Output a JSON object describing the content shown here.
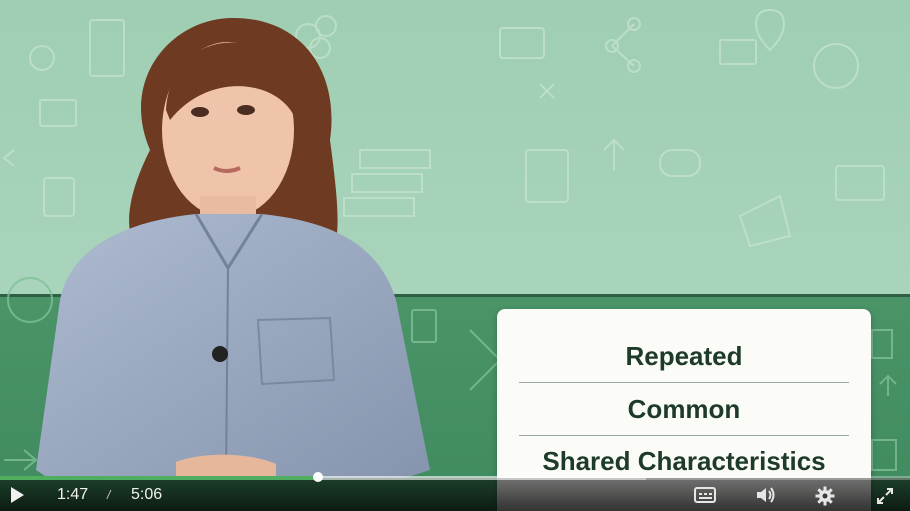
{
  "card": {
    "items": [
      "Repeated",
      "Common",
      "Shared Characteristics"
    ]
  },
  "player": {
    "current_time": "1:47",
    "separator": "/",
    "duration": "5:06",
    "progress": 0.349,
    "buffered": 0.71
  },
  "icons": {
    "play": "play-icon",
    "captions": "captions-icon",
    "volume": "volume-icon",
    "settings": "gear-icon",
    "fullscreen": "fullscreen-icon"
  },
  "colors": {
    "bg_top": "#a3cfb4",
    "bg_bottom": "#4f9a6e",
    "progress": "#4fae5f",
    "card_text": "#1d3a2a"
  }
}
